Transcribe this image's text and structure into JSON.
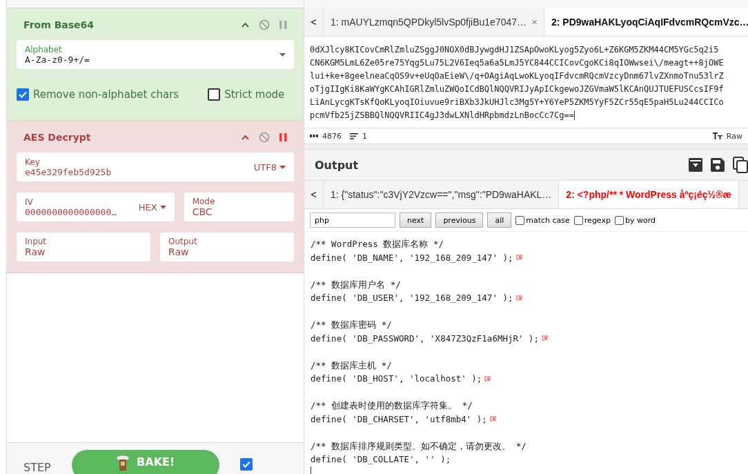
{
  "recipe": {
    "operations": [
      {
        "kind": "base64",
        "title": "From Base64",
        "breakpoint": false,
        "fields": [
          {
            "kind": "select",
            "label": "Alphabet",
            "value": "A-Za-z0-9+/="
          }
        ],
        "options": [
          {
            "label": "Remove non-alphabet chars",
            "checked": true
          },
          {
            "label": "Strict mode",
            "checked": false
          }
        ]
      },
      {
        "kind": "aes",
        "title": "AES Decrypt",
        "breakpoint": true,
        "fields": [
          {
            "kind": "toggle",
            "label": "Key",
            "value": "e45e329feb5d925b",
            "format": "UTF8"
          },
          {
            "kind": "toggle",
            "label": "IV",
            "value": "0000000000000000…",
            "format": "HEX"
          },
          {
            "kind": "text",
            "label": "Mode",
            "value": "CBC"
          },
          {
            "kind": "text",
            "label": "Input",
            "value": "Raw"
          },
          {
            "kind": "text",
            "label": "Output",
            "value": "Raw"
          }
        ]
      }
    ]
  },
  "controls": {
    "step": "STEP",
    "bake": "BAKE!",
    "auto_bake": true
  },
  "input": {
    "scroll_left": "<",
    "tabs": [
      {
        "label": "1: mAUYLzmqn5QPDkyl5lvSp0fjiBu1e7047…",
        "selected": false,
        "closable": true
      },
      {
        "label": "2: PD9waHAKLyoqCiAqIFdvcmRQcmVzc…",
        "selected": true,
        "closable": false
      }
    ],
    "lines": [
      "0dXJlcy8KICovCmRlZmluZSggJ0NOX0dBJywgdHJ1ZSApOwoKLyog5Zyo6L+Z6KGM5ZKM44CM5YGc5q2i5",
      "CN6KGM5LmL6Ze05re75Yqg5Lu75L2V6Ieq5a6a5LmJ5YC844CCICovCgoKCi8qIOWwsei\\/meagt++8jOWE",
      "lui+ke+8geelneaCqOS9v+eUqOaEieW\\/q+OAgiAqLwoKLyoqIFdvcmRQcmVzcyDnm67lvZXnmoTnu53lrZ",
      "oTjgIIgKi8KaWYgKCAhIGRlZmluZWQoICdBQlNQQVRIJyApICkgewoJZGVmaW5lKCAnQUJTUEFUSCcsIF9f",
      "LiAnLycgKTsKfQoKLyoqIOiuvue9riBXb3JkUHJlc3Mg5Y+Y6YeP5ZKM5YyF5ZCr55qE5paH5Lu244CCICo",
      "pcmVfb25jZSBBQlNQQVRIIC4gJ3dwLXNldHRpbmdzLnBocCc7Cg=="
    ],
    "status": {
      "chars": "4876",
      "lines": "1",
      "format": "Raw"
    }
  },
  "output": {
    "title": "Output",
    "scroll_left": "<",
    "tabs": [
      {
        "label": "1: {\"status\":\"c3VjY2Vzcw==\",\"msg\":\"PD9waHAKL…",
        "selected": false
      },
      {
        "label": "2: <?php/** * WordPress åºç¡éç½®æ",
        "selected": true
      }
    ],
    "search": {
      "value": "php",
      "buttons": [
        "next",
        "previous",
        "all"
      ],
      "options": [
        {
          "label": "match case",
          "checked": false
        },
        {
          "label": "regexp",
          "checked": false
        },
        {
          "label": "by word",
          "checked": false
        }
      ]
    },
    "lines": [
      {
        "kind": "code",
        "text": "/** WordPress 数据库名称 */",
        "cr": false
      },
      {
        "kind": "code",
        "text": "define( 'DB_NAME', '192_168_209_147' );",
        "cr": true
      },
      {
        "kind": "blank"
      },
      {
        "kind": "code",
        "text": "/** 数据库用户名 */",
        "cr": false
      },
      {
        "kind": "code",
        "text": "define( 'DB_USER', '192_168_209_147' );",
        "cr": true
      },
      {
        "kind": "blank"
      },
      {
        "kind": "code",
        "text": "/** 数据库密码 */",
        "cr": false
      },
      {
        "kind": "code",
        "text": "define( 'DB_PASSWORD', 'X847Z3QzF1a6MHjR' );",
        "cr": true
      },
      {
        "kind": "blank"
      },
      {
        "kind": "code",
        "text": "/** 数据库主机 */",
        "cr": false
      },
      {
        "kind": "code",
        "text": "define( 'DB_HOST', 'localhost' );",
        "cr": true
      },
      {
        "kind": "blank"
      },
      {
        "kind": "code",
        "text": "/** 创建表时使用的数据库字符集。 */",
        "cr": false
      },
      {
        "kind": "code",
        "text": "define( 'DB_CHARSET', 'utf8mb4' );",
        "cr": true
      },
      {
        "kind": "blank"
      },
      {
        "kind": "code",
        "text": "/** 数据库排序规则类型。如不确定，请勿更改。 */",
        "cr": false
      },
      {
        "kind": "code",
        "text": "define( 'DB_COLLATE', '' );",
        "cr": false
      }
    ]
  }
}
